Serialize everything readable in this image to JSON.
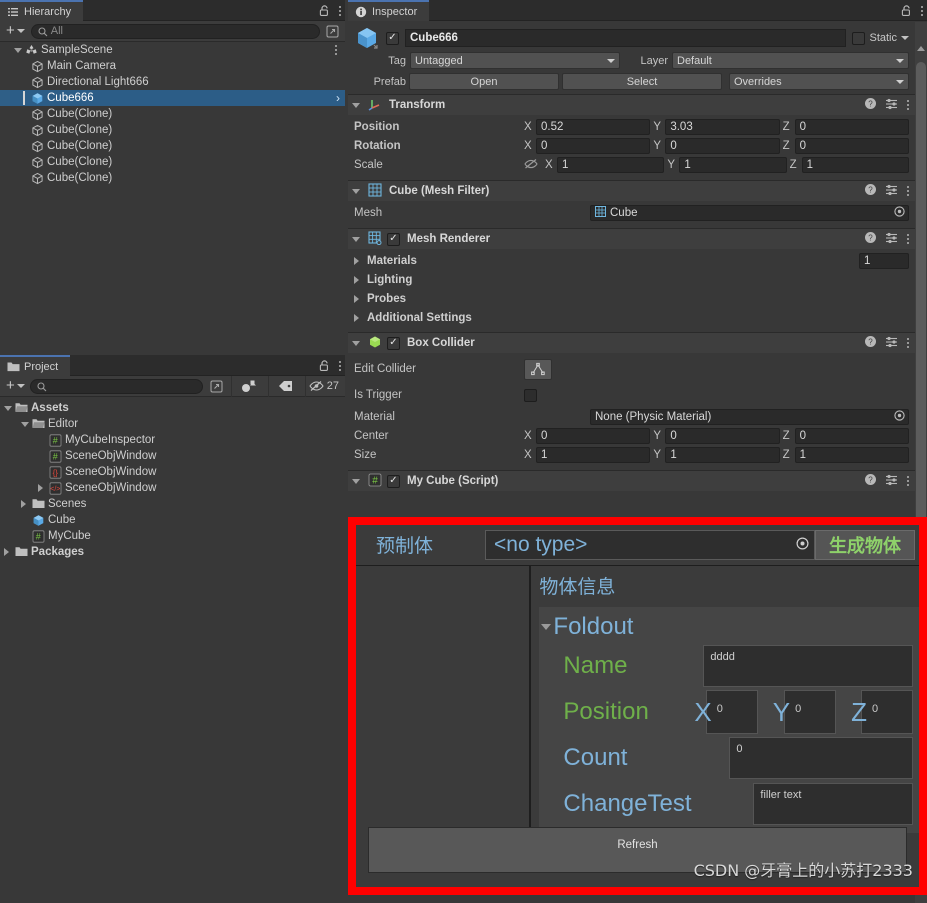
{
  "hierarchy": {
    "tab_label": "Hierarchy",
    "toolbar": {
      "add_label": "+",
      "search_placeholder": "All"
    },
    "items": [
      {
        "label": "SampleScene",
        "indent": 0,
        "icon": "scene-icon",
        "expanded": true,
        "selected": false,
        "kebab": true
      },
      {
        "label": "Main Camera",
        "indent": 1,
        "icon": "gameobject-icon",
        "selected": false
      },
      {
        "label": "Directional Light666",
        "indent": 1,
        "icon": "gameobject-icon",
        "selected": false
      },
      {
        "label": "Cube666",
        "indent": 1,
        "icon": "cube-icon-blue",
        "selected": true
      },
      {
        "label": "Cube(Clone)",
        "indent": 1,
        "icon": "gameobject-icon",
        "selected": false
      },
      {
        "label": "Cube(Clone)",
        "indent": 1,
        "icon": "gameobject-icon",
        "selected": false
      },
      {
        "label": "Cube(Clone)",
        "indent": 1,
        "icon": "gameobject-icon",
        "selected": false
      },
      {
        "label": "Cube(Clone)",
        "indent": 1,
        "icon": "gameobject-icon",
        "selected": false
      },
      {
        "label": "Cube(Clone)",
        "indent": 1,
        "icon": "gameobject-icon",
        "selected": false
      }
    ]
  },
  "project": {
    "tab_label": "Project",
    "toolbar": {
      "add_label": "+",
      "search_placeholder": "",
      "hidden_count": "27"
    },
    "items": [
      {
        "label": "Assets",
        "indent": 0,
        "icon": "folder-open-icon",
        "arrow": "down",
        "bold": true
      },
      {
        "label": "Editor",
        "indent": 1,
        "icon": "folder-open-icon",
        "arrow": "down",
        "bold": false
      },
      {
        "label": "MyCubeInspector",
        "indent": 2,
        "icon": "cs-script-icon",
        "arrow": "none"
      },
      {
        "label": "SceneObjWindow",
        "indent": 2,
        "icon": "cs-script-icon",
        "arrow": "none"
      },
      {
        "label": "SceneObjWindow",
        "indent": 2,
        "icon": "json-icon",
        "arrow": "none"
      },
      {
        "label": "SceneObjWindow",
        "indent": 2,
        "icon": "uxml-icon",
        "arrow": "right"
      },
      {
        "label": "Scenes",
        "indent": 1,
        "icon": "folder-icon",
        "arrow": "right"
      },
      {
        "label": "Cube",
        "indent": 1,
        "icon": "prefab-icon",
        "arrow": "none"
      },
      {
        "label": "MyCube",
        "indent": 1,
        "icon": "cs-script-icon",
        "arrow": "none"
      },
      {
        "label": "Packages",
        "indent": 0,
        "icon": "folder-icon",
        "arrow": "right",
        "bold": true
      }
    ]
  },
  "inspector": {
    "tab_label": "Inspector",
    "gameobject": {
      "enabled_checkmark": "✓",
      "name": "Cube666",
      "static_label": "Static",
      "tag_label": "Tag",
      "tag_value": "Untagged",
      "layer_label": "Layer",
      "layer_value": "Default",
      "prefab_label": "Prefab",
      "prefab_open": "Open",
      "prefab_select": "Select",
      "prefab_overrides": "Overrides"
    },
    "components": [
      {
        "name": "Transform",
        "rows": [
          {
            "label": "Position",
            "axes": [
              {
                "a": "X",
                "v": "0.52"
              },
              {
                "a": "Y",
                "v": "3.03"
              },
              {
                "a": "Z",
                "v": "0"
              }
            ]
          },
          {
            "label": "Rotation",
            "axes": [
              {
                "a": "X",
                "v": "0"
              },
              {
                "a": "Y",
                "v": "0"
              },
              {
                "a": "Z",
                "v": "0"
              }
            ]
          },
          {
            "label": "Scale",
            "axes": [
              {
                "a": "X",
                "v": "1"
              },
              {
                "a": "Y",
                "v": "1"
              },
              {
                "a": "Z",
                "v": "1"
              }
            ]
          }
        ]
      },
      {
        "name": "Cube (Mesh Filter)",
        "mesh_label": "Mesh",
        "mesh_value": "Cube"
      },
      {
        "name": "Mesh Renderer",
        "materials_label": "Materials",
        "materials_count": "1",
        "lighting_label": "Lighting",
        "probes_label": "Probes",
        "additional_label": "Additional Settings"
      },
      {
        "name": "Box Collider",
        "edit_collider_label": "Edit Collider",
        "is_trigger_label": "Is Trigger",
        "material_label": "Material",
        "material_value": "None (Physic Material)",
        "center_label": "Center",
        "center": [
          {
            "a": "X",
            "v": "0"
          },
          {
            "a": "Y",
            "v": "0"
          },
          {
            "a": "Z",
            "v": "0"
          }
        ],
        "size_label": "Size",
        "size": [
          {
            "a": "X",
            "v": "1"
          },
          {
            "a": "Y",
            "v": "1"
          },
          {
            "a": "Z",
            "v": "1"
          }
        ]
      },
      {
        "name": "My Cube (Script)"
      }
    ]
  },
  "custom_editor": {
    "prefab_label": "预制体",
    "prefab_field_value": "<no type>",
    "generate_button": "生成物体",
    "section_title": "物体信息",
    "foldout_label": "Foldout",
    "name_label": "Name",
    "name_value": "dddd",
    "position_label": "Position",
    "position": [
      {
        "a": "X",
        "v": "0"
      },
      {
        "a": "Y",
        "v": "0"
      },
      {
        "a": "Z",
        "v": "0"
      }
    ],
    "count_label": "Count",
    "count_value": "0",
    "changetest_label": "ChangeTest",
    "changetest_value": "filler text",
    "refresh_button": "Refresh",
    "accent_red": "#ff0000",
    "accent_green": "#6fb04a",
    "accent_blue": "#7fb2d9"
  },
  "watermark": "CSDN @牙膏上的小苏打2333"
}
